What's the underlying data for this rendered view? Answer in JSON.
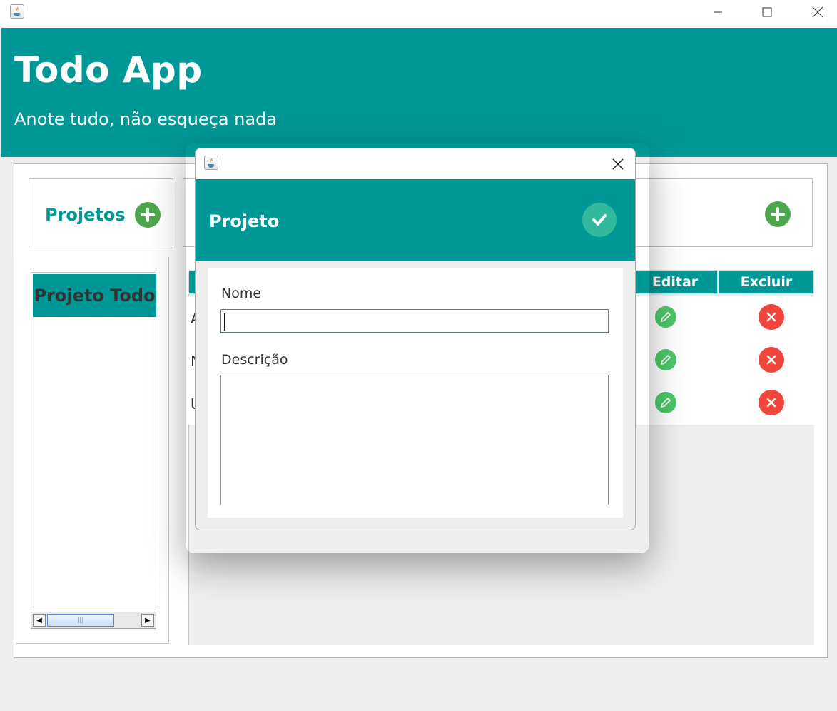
{
  "window": {
    "minimize_glyph": "—",
    "maximize_glyph": "☐",
    "close_glyph": "✕"
  },
  "header": {
    "title": "Todo App",
    "subtitle": "Anote tudo, não esqueça nada"
  },
  "projects": {
    "label": "Projetos",
    "items": [
      "Projeto Todo"
    ]
  },
  "tasks_table": {
    "columns": [
      "Editar",
      "Excluir"
    ],
    "rows": [
      {
        "visible_text": "A"
      },
      {
        "visible_text": "N"
      },
      {
        "visible_text": "U"
      }
    ]
  },
  "dialog": {
    "title": "Projeto",
    "name_label": "Nome",
    "name_value": "",
    "description_label": "Descrição",
    "description_value": ""
  },
  "colors": {
    "brand_teal": "#009797",
    "add_green": "#4ca64c",
    "edit_green": "#4cc76a",
    "delete_red": "#f0453a",
    "confirm_teal": "#32b89a"
  },
  "icons": {
    "app": "java-cup-icon",
    "add": "plus-icon",
    "confirm": "check-icon",
    "edit": "pencil-icon",
    "delete": "x-icon"
  }
}
